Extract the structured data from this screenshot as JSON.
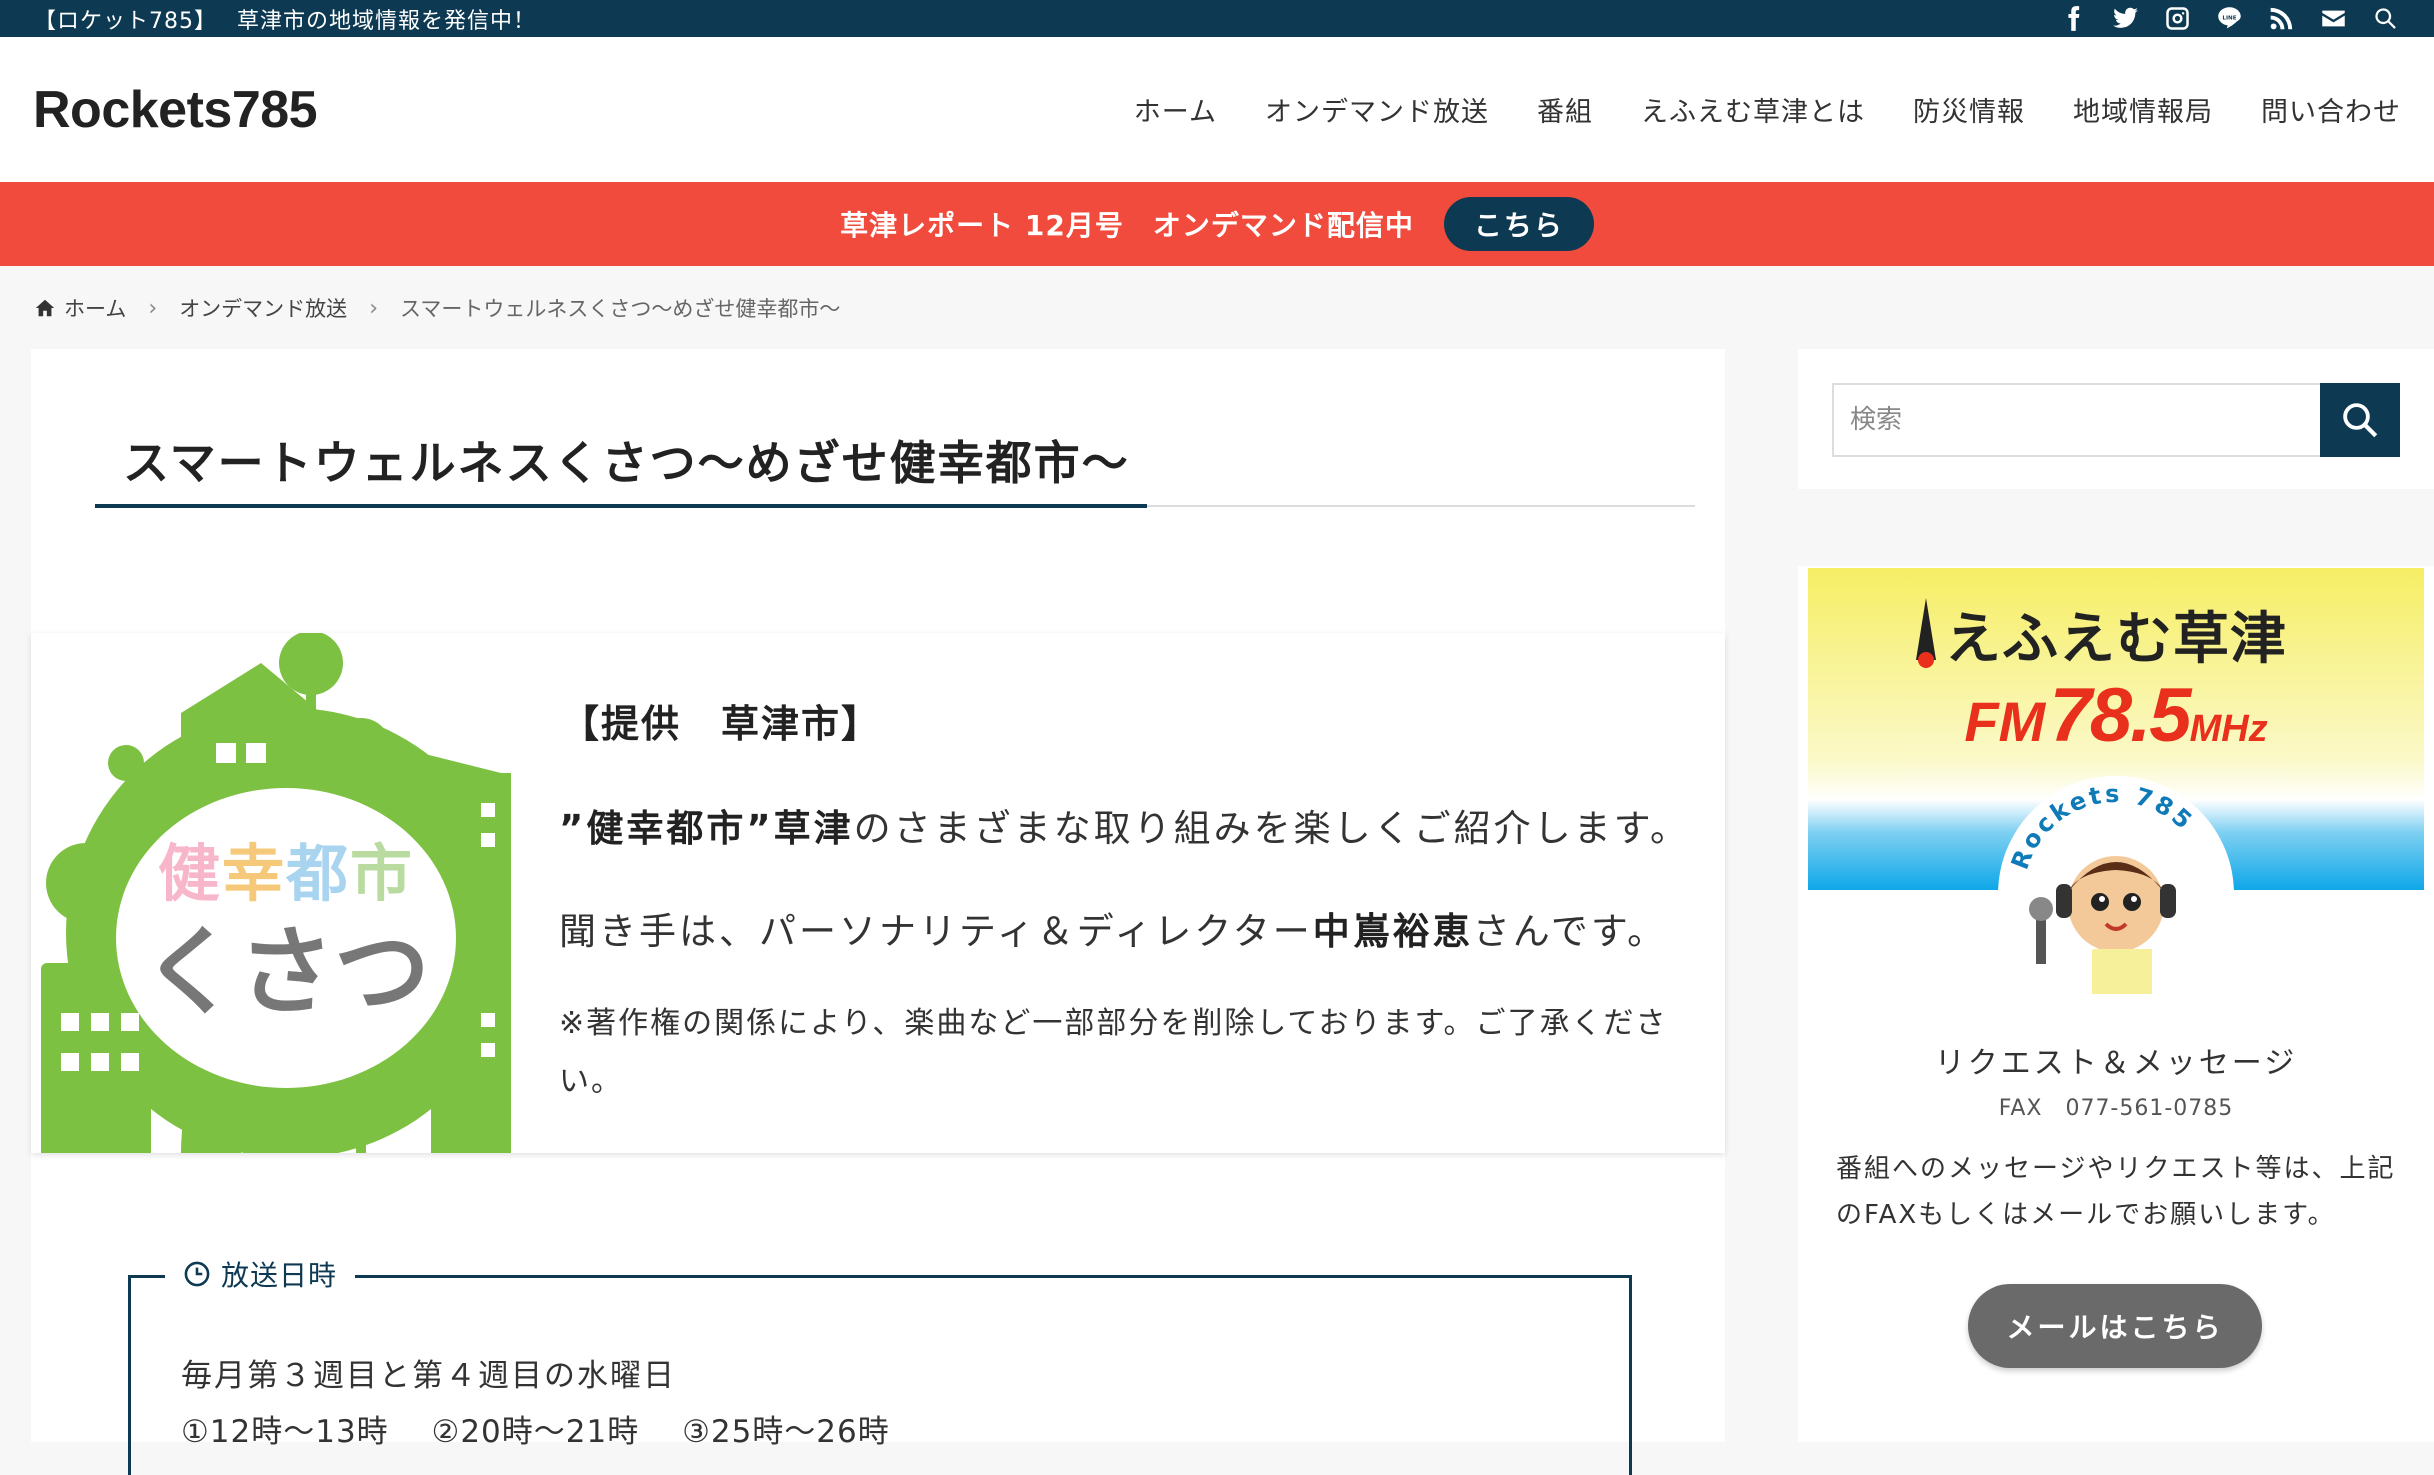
{
  "topbar": {
    "message": "【ロケット785】　 草津市の地域情報を発信中！",
    "icons": [
      "facebook-icon",
      "twitter-icon",
      "instagram-icon",
      "line-icon",
      "rss-icon",
      "mail-icon",
      "search-icon"
    ]
  },
  "header": {
    "logo": "Rockets785",
    "nav": [
      "ホーム",
      "オンデマンド放送",
      "番組",
      "えふえむ草津とは",
      "防災情報",
      "地域情報局",
      "問い合わせ"
    ]
  },
  "notice": {
    "text": "草津レポート 12月号　オンデマンド配信中",
    "button": "こちら"
  },
  "breadcrumb": {
    "home": "ホーム",
    "section": "オンデマンド放送",
    "current": "スマートウェルネスくさつ〜めざせ健幸都市〜"
  },
  "article": {
    "title": "スマートウェルネスくさつ〜めざせ健幸都市〜",
    "logo_text_top": "健幸都市",
    "logo_text_bottom": "くさつ",
    "sponsor": "【提供　草津市】",
    "line1_bold": "”健幸都市”草津",
    "line1_rest": "のさまざまな取り組みを楽しくご紹介します。",
    "line2_pre": "聞き手は、パーソナリティ＆ディレクター",
    "line2_bold": "中嶌裕恵",
    "line2_post": "さんです。",
    "note": "※著作権の関係により、楽曲など一部部分を削除しております。ご了承ください。"
  },
  "schedule": {
    "legend": "放送日時",
    "line1": "毎月第３週目と第４週目の水曜日",
    "line2": "①12時〜13時　 ②20時〜21時　 ③25時〜26時"
  },
  "sidebar": {
    "search_placeholder": "検索",
    "banner_brand": "えふえむ草津",
    "banner_fm": "FM",
    "banner_freq": "78.5",
    "banner_unit": "MHz",
    "mascot_arc": "Rockets 785",
    "request_title": "リクエスト＆メッセージ",
    "request_fax": "FAX　077-561-0785",
    "request_body": "番組へのメッセージやリクエスト等は、上記のFAXもしくはメールでお願いします。",
    "mail_button": "メールはこちら"
  },
  "colors": {
    "navy": "#0d3a52",
    "notice_red": "#f04b3c",
    "logo_green": "#7dc142",
    "freq_red": "#e8301c"
  }
}
